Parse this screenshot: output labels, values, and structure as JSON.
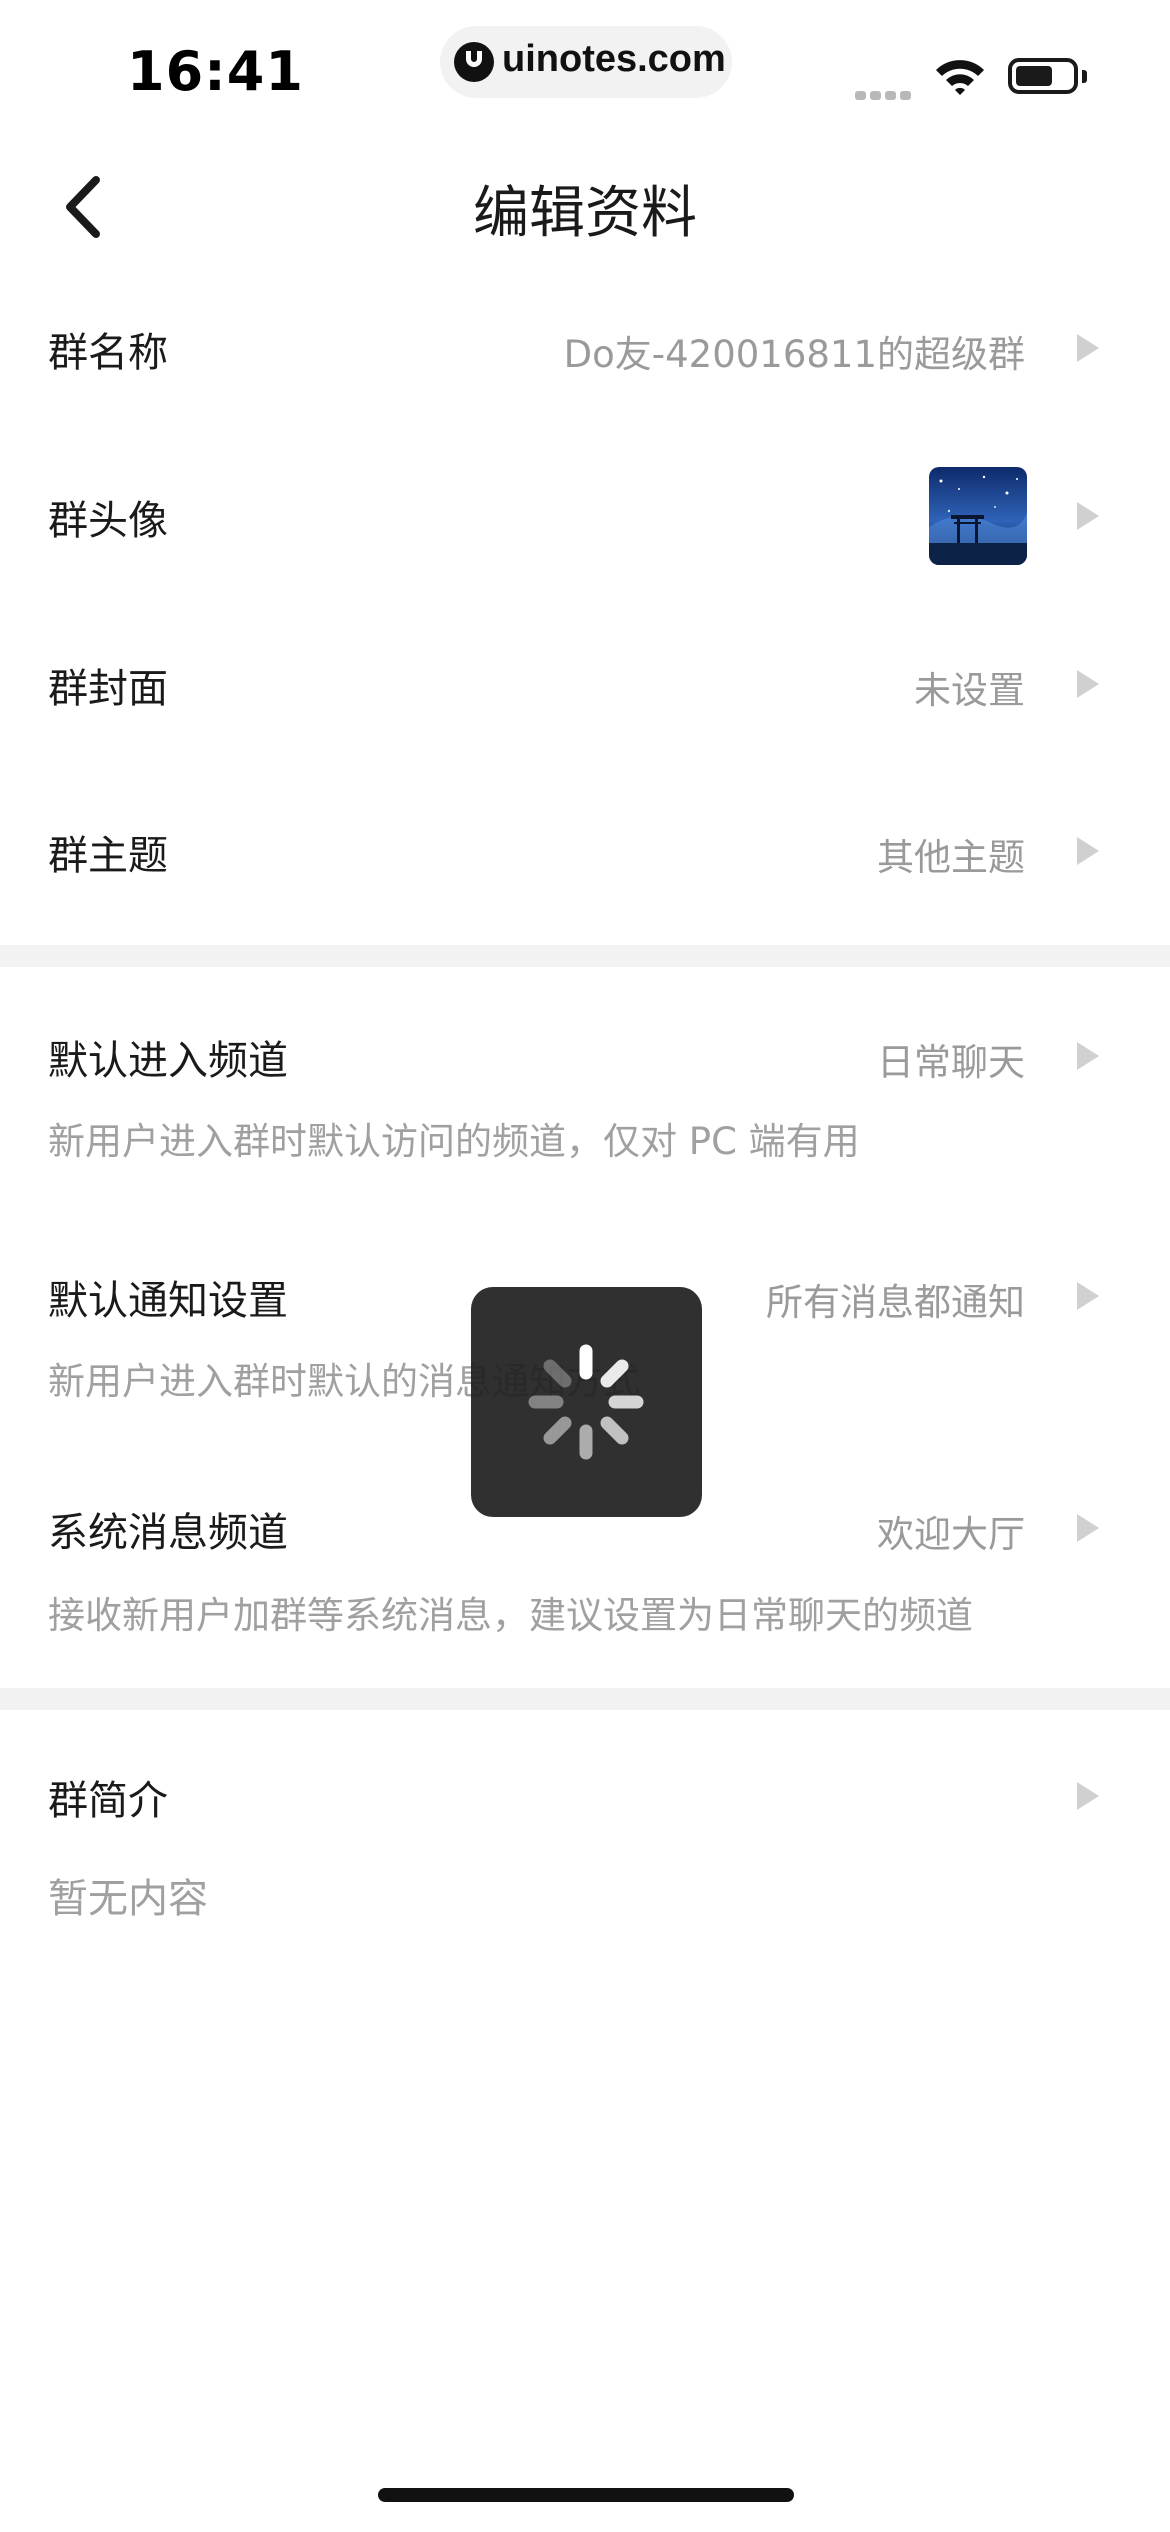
{
  "status_bar": {
    "time": "16:41",
    "url": "uinotes.com"
  },
  "nav": {
    "title": "编辑资料"
  },
  "group_info": {
    "name_label": "群名称",
    "name_value": "Do友-420016811的超级群",
    "avatar_label": "群头像",
    "cover_label": "群封面",
    "cover_value": "未设置",
    "theme_label": "群主题",
    "theme_value": "其他主题"
  },
  "channel_settings": {
    "default_channel_label": "默认进入频道",
    "default_channel_value": "日常聊天",
    "default_channel_desc": "新用户进入群时默认访问的频道，仅对 PC 端有用",
    "default_notify_label": "默认通知设置",
    "default_notify_value": "所有消息都通知",
    "default_notify_desc": "新用户进入群时默认的消息通知方式",
    "system_channel_label": "系统消息频道",
    "system_channel_value": "欢迎大厅",
    "system_channel_desc": "接收新用户加群等系统消息，建议设置为日常聊天的频道"
  },
  "intro": {
    "label": "群简介",
    "value": "暂无内容"
  },
  "icons": {
    "back": "chevron-left-icon",
    "row_arrow": "triangle-right-icon",
    "loading": "spinner-icon"
  },
  "colors": {
    "label_text": "#1a1a1a",
    "value_text": "#9a9a9a",
    "separator": "#f2f2f2",
    "loading_bg": "#1e1e1e"
  }
}
